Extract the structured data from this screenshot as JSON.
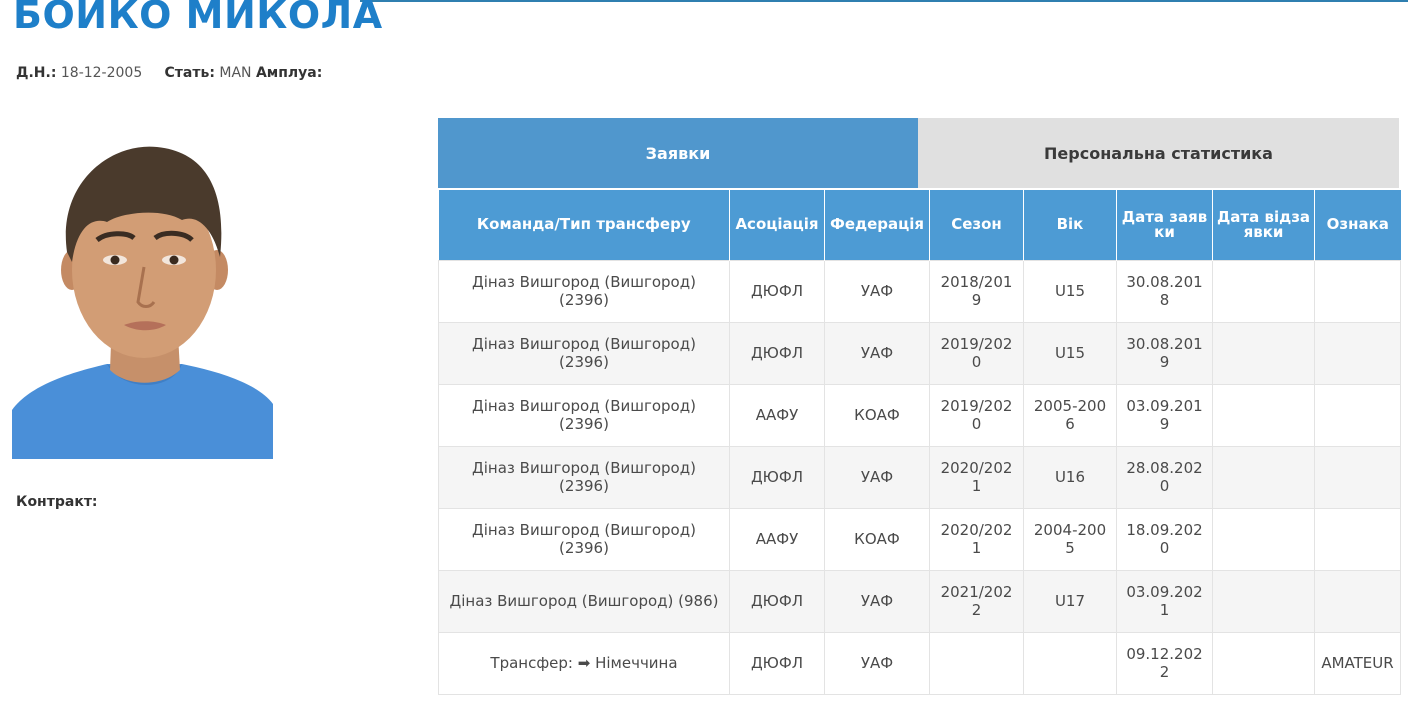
{
  "player": {
    "name": "БОЙКО МИКОЛА",
    "dob_label": "Д.Н.:",
    "dob": "18-12-2005",
    "gender_label": "Стать:",
    "gender": "MAN",
    "position_label": "Амплуа:",
    "position": "",
    "contract_label": "Контракт:",
    "contract": ""
  },
  "colors": {
    "name": "#1e7fc9",
    "accent": "#4d9bd4",
    "tab_inactive": "#e0e0e0",
    "shirt": "#4a8fd8"
  },
  "tabs": [
    {
      "label": "Заявки",
      "active": true
    },
    {
      "label": "Персональна статистика",
      "active": false
    }
  ],
  "table": {
    "headers": [
      "Команда/Тип трансферу",
      "Асоціація",
      "Федерація",
      "Сезон",
      "Вік",
      "Дата заявки",
      "Дата відзаявки",
      "Ознака"
    ],
    "rows": [
      [
        "Діназ Вишгород (Вишгород) (2396)",
        "ДЮФЛ",
        "УАФ",
        "2018/2019",
        "U15",
        "30.08.2018",
        "",
        ""
      ],
      [
        "Діназ Вишгород (Вишгород) (2396)",
        "ДЮФЛ",
        "УАФ",
        "2019/2020",
        "U15",
        "30.08.2019",
        "",
        ""
      ],
      [
        "Діназ Вишгород (Вишгород) (2396)",
        "ААФУ",
        "КОАФ",
        "2019/2020",
        "2005-2006",
        "03.09.2019",
        "",
        ""
      ],
      [
        "Діназ Вишгород (Вишгород) (2396)",
        "ДЮФЛ",
        "УАФ",
        "2020/2021",
        "U16",
        "28.08.2020",
        "",
        ""
      ],
      [
        "Діназ Вишгород (Вишгород) (2396)",
        "ААФУ",
        "КОАФ",
        "2020/2021",
        "2004-2005",
        "18.09.2020",
        "",
        ""
      ],
      [
        "Діназ Вишгород (Вишгород) (986)",
        "ДЮФЛ",
        "УАФ",
        "2021/2022",
        "U17",
        "03.09.2021",
        "",
        ""
      ],
      [
        "Трансфер: ➡ Німеччина",
        "ДЮФЛ",
        "УАФ",
        "",
        "",
        "09.12.2022",
        "",
        "AMATEUR"
      ]
    ]
  }
}
